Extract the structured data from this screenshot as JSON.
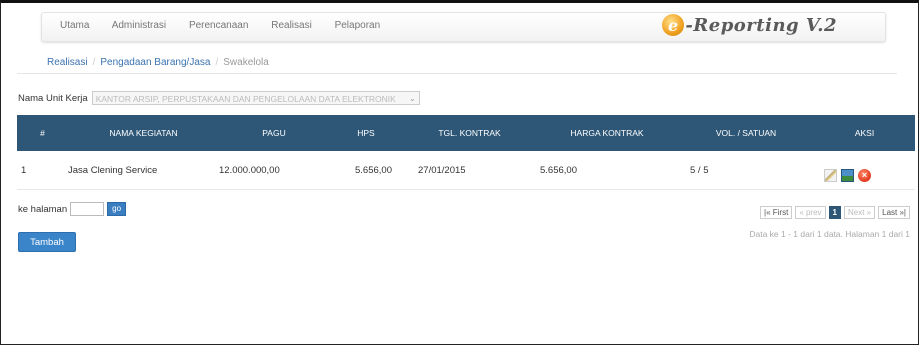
{
  "nav": {
    "items": [
      "Utama",
      "Administrasi",
      "Perencanaan",
      "Realisasi",
      "Pelaporan"
    ],
    "logo_e": "e",
    "logo_text": "-Reporting V.2"
  },
  "breadcrumb": [
    "Realisasi",
    "Pengadaan Barang/Jasa",
    "Swakelola"
  ],
  "unit": {
    "label": "Nama Unit Kerja",
    "value": "KANTOR ARSIP, PERPUSTAKAAN DAN PENGELOLAAN DATA ELEKTRONIK"
  },
  "table": {
    "headers": [
      "#",
      "NAMA KEGIATAN",
      "PAGU",
      "HPS",
      "TGL. KONTRAK",
      "HARGA KONTRAK",
      "VOL. / SATUAN",
      "AKSI"
    ],
    "rows": [
      [
        "1",
        "Jasa Clening Service",
        "12.000.000,00",
        "5.656,00",
        "27/01/2015",
        "5.656,00",
        "5 / 5"
      ]
    ]
  },
  "goto": {
    "label": "ke halaman",
    "button": "go"
  },
  "add_button": "Tambah",
  "pager": {
    "first": "|« First",
    "prev": "« prev",
    "current": "1",
    "next": "Next »",
    "last": "Last »|"
  },
  "pager_info": "Data ke 1 - 1 dari 1 data. Halaman 1 dari 1"
}
